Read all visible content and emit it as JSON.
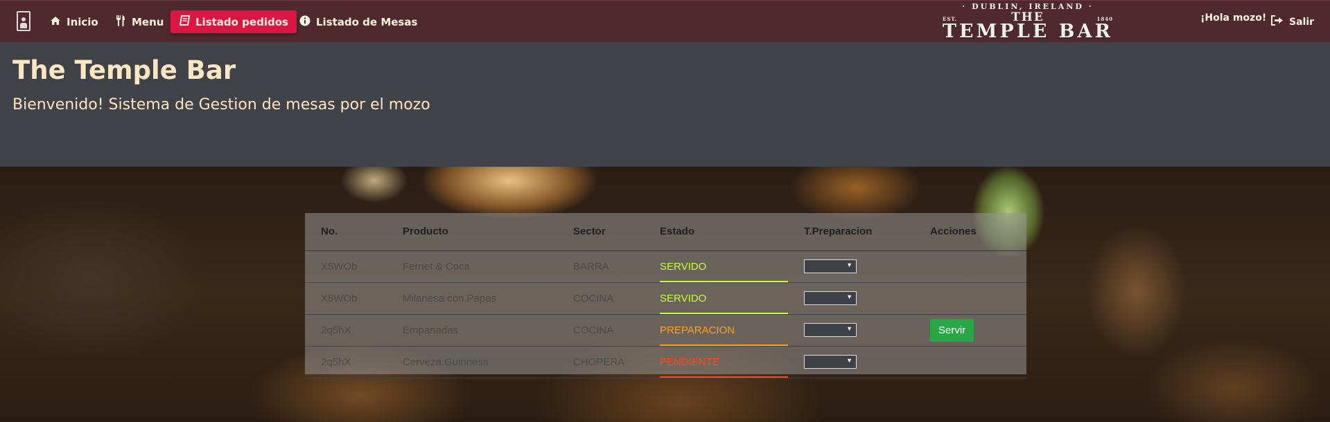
{
  "nav": {
    "items": [
      {
        "label": "Inicio",
        "icon": "home-icon"
      },
      {
        "label": "Menu",
        "icon": "utensils-icon"
      },
      {
        "label": "Listado pedidos",
        "icon": "book-icon"
      },
      {
        "label": "Listado de Mesas",
        "icon": "info-circle-icon"
      }
    ],
    "active_index": 2,
    "active_color": "#dc1642",
    "greeting": "¡Hola mozo!",
    "logout_label": "Salir"
  },
  "logo": {
    "top": "· DUBLIN, IRELAND ·",
    "est": "EST.",
    "the": "THE",
    "year": "1840",
    "main": "TEMPLE BAR"
  },
  "hero": {
    "title": "The Temple Bar",
    "subtitle": "Bienvenido! Sistema de Gestion de mesas por el mozo"
  },
  "table": {
    "headers": [
      "No.",
      "Producto",
      "Sector",
      "Estado",
      "T.Preparacion",
      "Acciones"
    ],
    "rows": [
      {
        "no": "X5WOb",
        "producto": "Fernet & Coca",
        "sector": "BARRA",
        "estado": "SERVIDO",
        "estado_color": "#c6ff3a",
        "action": ""
      },
      {
        "no": "X5WOb",
        "producto": "Milanesa con Papas",
        "sector": "COCINA",
        "estado": "SERVIDO",
        "estado_color": "#c6ff3a",
        "action": ""
      },
      {
        "no": "2q5hX",
        "producto": "Empanadas",
        "sector": "COCINA",
        "estado": "PREPARACION",
        "estado_color": "#ffa21a",
        "action": "Servir"
      },
      {
        "no": "2q5hX",
        "producto": "Cerveza Guinness",
        "sector": "CHOPERA",
        "estado": "PENDIENTE",
        "estado_color": "#ff4a1a",
        "action": ""
      }
    ]
  }
}
